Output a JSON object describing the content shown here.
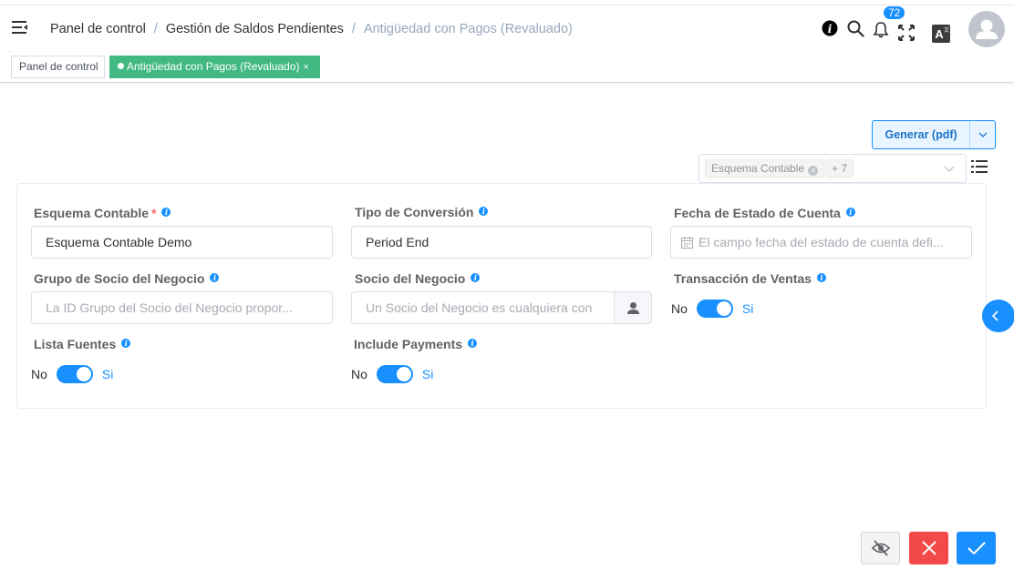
{
  "breadcrumb": [
    {
      "label": "Panel de control"
    },
    {
      "label": "Gestión de Saldos Pendientes"
    },
    {
      "label": "Antigüedad con Pagos (Revaluado)"
    }
  ],
  "header": {
    "separator": "/",
    "notifications_count": "72",
    "icons": [
      "menu-fold-icon",
      "info-icon",
      "search-icon",
      "bell-icon",
      "fullscreen-icon",
      "translate-icon",
      "user-avatar"
    ]
  },
  "tags": {
    "dashboard": "Panel de control",
    "active": "Antigüedad con Pagos (Revaluado)",
    "close": "×"
  },
  "toolbar": {
    "generate_label": "Generar (pdf)",
    "schema_chip": "Esquema Contable",
    "more_chip": "+ 7"
  },
  "form": {
    "esquema_contable": {
      "label": "Esquema Contable",
      "required_mark": "*",
      "value": "Esquema Contable Demo"
    },
    "tipo_conversion": {
      "label": "Tipo de Conversión",
      "value": "Period End"
    },
    "fecha_estado": {
      "label": "Fecha de Estado de Cuenta",
      "placeholder": "El campo fecha del estado de cuenta defi..."
    },
    "grupo_socio": {
      "label": "Grupo de Socio del Negocio",
      "placeholder": "La ID Grupo del Socio del Negocio propor..."
    },
    "socio_negocio": {
      "label": "Socio del Negocio",
      "placeholder": "Un Socio del Negocio es cualquiera con"
    },
    "transaccion_ventas": {
      "label": "Transacción de Ventas",
      "off": "No",
      "on": "Si",
      "value": true
    },
    "lista_fuentes": {
      "label": "Lista Fuentes",
      "off": "No",
      "on": "Si",
      "value": true
    },
    "include_payments": {
      "label": "Include Payments",
      "off": "No",
      "on": "Si",
      "value": true
    }
  },
  "info_glyph": "i",
  "colors": {
    "primary": "#1890ff",
    "active_tag": "#42b983",
    "danger": "#f44949",
    "label": "#606266"
  }
}
